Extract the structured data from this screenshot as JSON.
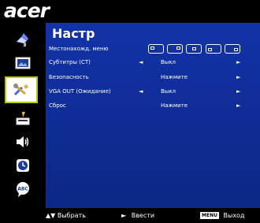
{
  "brand": {
    "logo_text": "acer"
  },
  "sidebar": {
    "items": [
      {
        "icon": "picture-adjust-icon"
      },
      {
        "icon": "image-position-icon"
      },
      {
        "icon": "setup-tools-icon",
        "active": true
      },
      {
        "icon": "management-icon"
      },
      {
        "icon": "audio-icon"
      },
      {
        "icon": "timer-icon"
      },
      {
        "icon": "language-icon",
        "text": "ABC"
      }
    ]
  },
  "panel": {
    "title": "Настр",
    "rows": [
      {
        "label": "Местонахожд. меню",
        "value": "",
        "arrows": false,
        "position_icons": true
      },
      {
        "label": "Субтитры (СТ)",
        "value": "Выкл",
        "arrows": true
      },
      {
        "label": "Безопасность",
        "value": "Нажмите",
        "arrows": false
      },
      {
        "label": "VGA OUT (Ожидание)",
        "value": "Выкл",
        "arrows": true
      },
      {
        "label": "Сброс",
        "value": "Нажмите",
        "arrows": false
      }
    ],
    "arrows": {
      "left": "◄",
      "right": "►"
    }
  },
  "footer": {
    "select_symbol": "▲▼",
    "select_label": "Выбрать",
    "enter_symbol": "►",
    "enter_label": "Ввести",
    "menu_key": "MENU",
    "exit_label": "Выход"
  },
  "colors": {
    "background": "#0d2c84",
    "sidebar": "#000000",
    "active_border": "#b9c800"
  }
}
